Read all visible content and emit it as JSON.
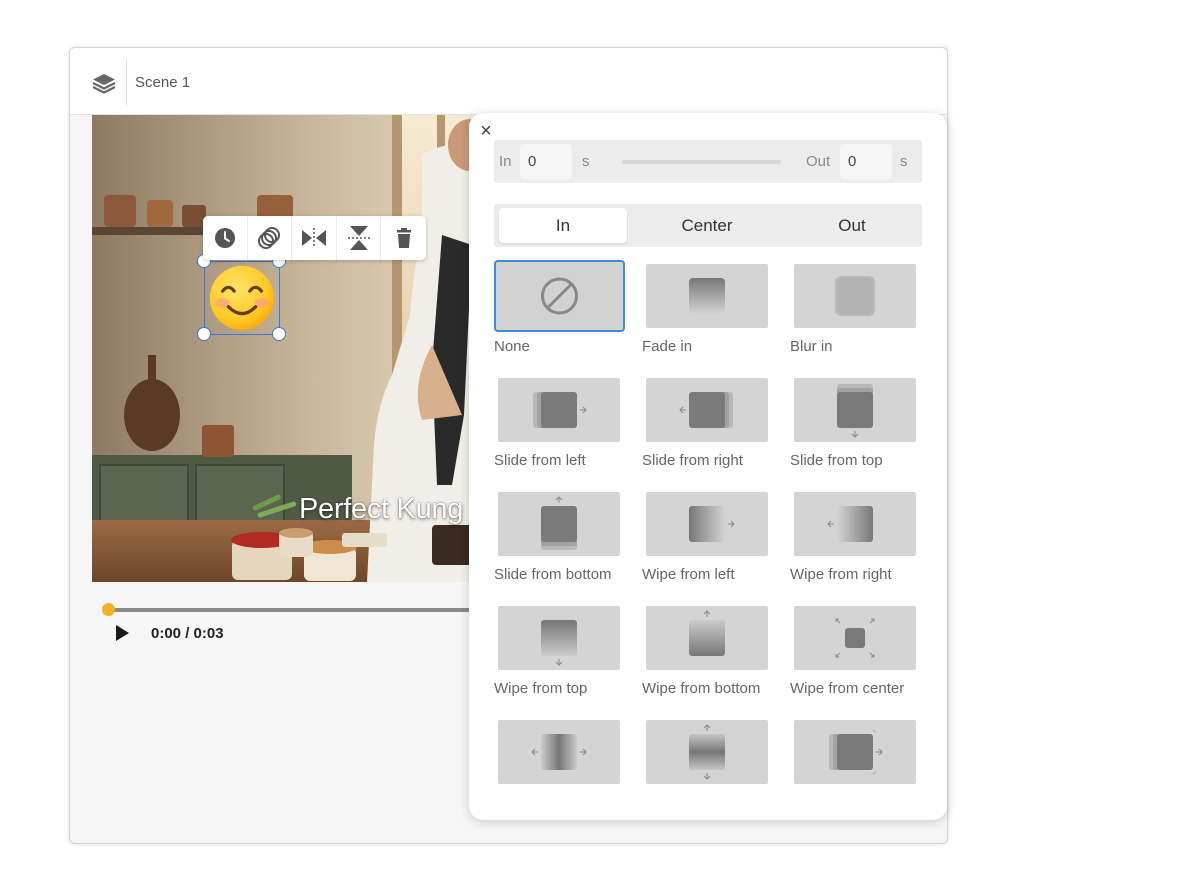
{
  "header": {
    "scene_title": "Scene 1"
  },
  "video": {
    "caption": "Perfect Kung"
  },
  "sticker": {
    "emoji": "😊"
  },
  "player": {
    "time": "0:00 / 0:03",
    "progress": 0.0
  },
  "panel": {
    "close_label": "×",
    "timing": {
      "in_label": "In",
      "in_value": "0",
      "in_unit": "s",
      "out_label": "Out",
      "out_value": "0",
      "out_unit": "s"
    },
    "tabs": [
      {
        "label": "In"
      },
      {
        "label": "Center"
      },
      {
        "label": "Out"
      }
    ],
    "active_tab": "In",
    "effects": [
      {
        "label": "None",
        "icon": "none-icon",
        "selected": true
      },
      {
        "label": "Fade in",
        "icon": "fade-in-icon"
      },
      {
        "label": "Blur in",
        "icon": "blur-in-icon"
      },
      {
        "label": "Slide from left",
        "icon": "slide-left-icon"
      },
      {
        "label": "Slide from right",
        "icon": "slide-right-icon"
      },
      {
        "label": "Slide from top",
        "icon": "slide-top-icon"
      },
      {
        "label": "Slide from bottom",
        "icon": "slide-bottom-icon"
      },
      {
        "label": "Wipe from left",
        "icon": "wipe-left-icon"
      },
      {
        "label": "Wipe from right",
        "icon": "wipe-right-icon"
      },
      {
        "label": "Wipe from top",
        "icon": "wipe-top-icon"
      },
      {
        "label": "Wipe from bottom",
        "icon": "wipe-bottom-icon"
      },
      {
        "label": "Wipe from center",
        "icon": "wipe-center-icon"
      },
      {
        "label": "",
        "icon": "split-horizontal-icon"
      },
      {
        "label": "",
        "icon": "split-vertical-icon"
      },
      {
        "label": "",
        "icon": "zoom-out-icon"
      }
    ]
  },
  "colors": {
    "selection": "#3c78d8",
    "progress_knob": "#f0b323",
    "selected_effect": "#3c8cdc"
  }
}
